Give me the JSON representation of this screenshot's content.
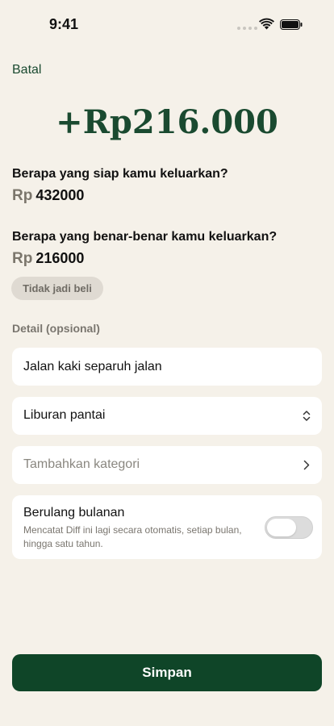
{
  "status_bar": {
    "time": "9:41"
  },
  "header": {
    "cancel_label": "Batal"
  },
  "diff": {
    "amount": "+Rp216.000"
  },
  "planned": {
    "question": "Berapa yang siap kamu keluarkan?",
    "currency": "Rp",
    "value": "432000"
  },
  "actual": {
    "question": "Berapa yang benar-benar kamu keluarkan?",
    "currency": "Rp",
    "value": "216000"
  },
  "chip": {
    "label": "Tidak jadi beli"
  },
  "details": {
    "section_label": "Detail (opsional)",
    "note_value": "Jalan kaki separuh jalan",
    "goal_value": "Liburan pantai",
    "category_placeholder": "Tambahkan kategori"
  },
  "recurring": {
    "title": "Berulang bulanan",
    "description": "Mencatat Diff ini lagi secara otomatis, setiap bulan, hingga satu tahun.",
    "enabled": false
  },
  "save_label": "Simpan",
  "colors": {
    "background": "#f5f1e9",
    "accent": "#1a4a30",
    "button": "#0f4528",
    "card": "#ffffff"
  }
}
